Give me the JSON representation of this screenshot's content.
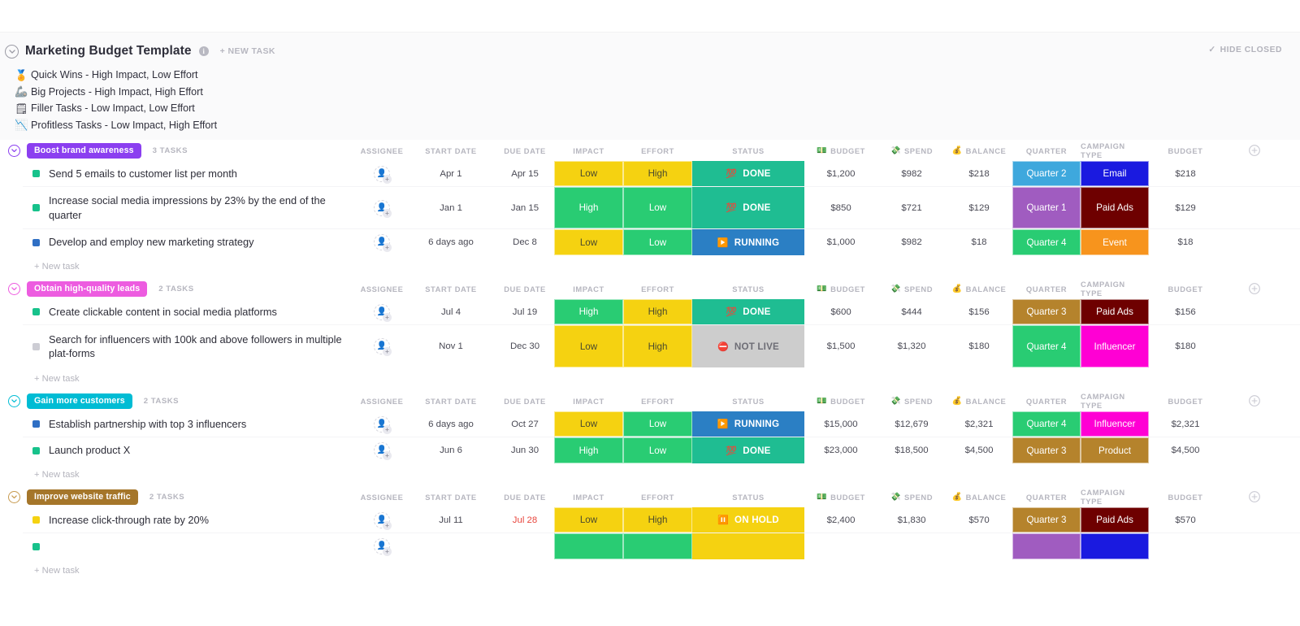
{
  "header": {
    "title": "Marketing Budget Template",
    "info_icon": "info-icon",
    "new_task_label": "+ NEW TASK",
    "hide_closed_label": "HIDE CLOSED",
    "hide_closed_check": "✓",
    "legend": [
      {
        "emoji": "🏅",
        "text": "Quick Wins - High Impact, Low Effort"
      },
      {
        "emoji": "🦾",
        "text": "Big Projects - High Impact, High Effort"
      },
      {
        "emoji": "🗒",
        "text": "Filler Tasks - Low Impact, Low Effort"
      },
      {
        "emoji": "📉",
        "text": "Profitless Tasks - Low Impact, High Effort"
      }
    ]
  },
  "columns": {
    "assignee": "ASSIGNEE",
    "start_date": "START DATE",
    "due_date": "DUE DATE",
    "impact": "IMPACT",
    "effort": "EFFORT",
    "status": "STATUS",
    "budget": "BUDGET",
    "budget_emoji": "💵",
    "spend": "SPEND",
    "spend_emoji": "💸",
    "balance": "BALANCE",
    "balance_emoji": "💰",
    "quarter": "QUARTER",
    "campaign_type": "CAMPAIGN TYPE",
    "budget2": "BUDGET",
    "add_column": "+"
  },
  "palette": {
    "impact_high": "#29cc73",
    "impact_low": "#f5d211",
    "effort_high": "#f5d211",
    "effort_low": "#29cc73",
    "status_done": "#1fbd92",
    "status_running": "#2b7fc4",
    "status_not_live": "#cdcdcd",
    "status_on_hold": "#f5d211",
    "quarter1": "#a05cc0",
    "quarter2": "#3ea8dd",
    "quarter3": "#b5832c",
    "quarter4": "#29cc73",
    "campaign_email": "#1a1ae0",
    "campaign_paid_ads": "#6e0000",
    "campaign_event": "#f7941d",
    "campaign_influencer": "#ff00d4",
    "campaign_product": "#b5832c"
  },
  "new_task_label": "+ New task",
  "groups": [
    {
      "name": "Boost brand awareness",
      "badge_color": "#8b3ff0",
      "chev_color": "#8b3ff0",
      "task_count": "3 TASKS",
      "tasks": [
        {
          "priority_color": "#17c28b",
          "name": "Send 5 emails to customer list per month",
          "start_date": "Apr 1",
          "due_date": "Apr 15",
          "due_overdue": false,
          "impact": "Low",
          "impact_color": "#f5d211",
          "impact_text": "#4a4a2e",
          "effort": "High",
          "effort_color": "#f5d211",
          "effort_text": "#4a4a2e",
          "status": "DONE",
          "status_emoji": "💯",
          "status_color": "#1fbd92",
          "status_text": "#ffffff",
          "budget": "$1,200",
          "spend": "$982",
          "balance": "$218",
          "quarter": "Quarter 2",
          "quarter_color": "#3ea8dd",
          "campaign": "Email",
          "campaign_color": "#1a1ae0",
          "budget2": "$218"
        },
        {
          "priority_color": "#17c28b",
          "name": "Increase social media impressions by 23% by the end of the quarter",
          "start_date": "Jan 1",
          "due_date": "Jan 15",
          "due_overdue": false,
          "impact": "High",
          "impact_color": "#29cc73",
          "impact_text": "#ffffff",
          "effort": "Low",
          "effort_color": "#29cc73",
          "effort_text": "#ffffff",
          "status": "DONE",
          "status_emoji": "💯",
          "status_color": "#1fbd92",
          "status_text": "#ffffff",
          "budget": "$850",
          "spend": "$721",
          "balance": "$129",
          "quarter": "Quarter 1",
          "quarter_color": "#a05cc0",
          "campaign": "Paid Ads",
          "campaign_color": "#6e0000",
          "budget2": "$129"
        },
        {
          "priority_color": "#2f6fc4",
          "name": "Develop and employ new marketing strategy",
          "start_date": "6 days ago",
          "due_date": "Dec 8",
          "due_overdue": false,
          "impact": "Low",
          "impact_color": "#f5d211",
          "impact_text": "#4a4a2e",
          "effort": "Low",
          "effort_color": "#29cc73",
          "effort_text": "#ffffff",
          "status": "RUNNING",
          "status_emoji": "▶️",
          "status_color": "#2b7fc4",
          "status_text": "#ffffff",
          "budget": "$1,000",
          "spend": "$982",
          "balance": "$18",
          "quarter": "Quarter 4",
          "quarter_color": "#29cc73",
          "campaign": "Event",
          "campaign_color": "#f7941d",
          "budget2": "$18"
        }
      ]
    },
    {
      "name": "Obtain high-quality leads",
      "badge_color": "#ed5ce0",
      "chev_color": "#ed5ce0",
      "task_count": "2 TASKS",
      "tasks": [
        {
          "priority_color": "#17c28b",
          "name": "Create clickable content in social media platforms",
          "start_date": "Jul 4",
          "due_date": "Jul 19",
          "due_overdue": false,
          "impact": "High",
          "impact_color": "#29cc73",
          "impact_text": "#ffffff",
          "effort": "High",
          "effort_color": "#f5d211",
          "effort_text": "#4a4a2e",
          "status": "DONE",
          "status_emoji": "💯",
          "status_color": "#1fbd92",
          "status_text": "#ffffff",
          "budget": "$600",
          "spend": "$444",
          "balance": "$156",
          "quarter": "Quarter 3",
          "quarter_color": "#b5832c",
          "campaign": "Paid Ads",
          "campaign_color": "#6e0000",
          "budget2": "$156"
        },
        {
          "priority_color": "#cdcdd4",
          "name": "Search for influencers with 100k and above followers in multiple plat-forms",
          "start_date": "Nov 1",
          "due_date": "Dec 30",
          "due_overdue": false,
          "impact": "Low",
          "impact_color": "#f5d211",
          "impact_text": "#4a4a2e",
          "effort": "High",
          "effort_color": "#f5d211",
          "effort_text": "#4a4a2e",
          "status": "NOT LIVE",
          "status_emoji": "⛔",
          "status_color": "#cdcdcd",
          "status_text": "#6d6d75",
          "budget": "$1,500",
          "spend": "$1,320",
          "balance": "$180",
          "quarter": "Quarter 4",
          "quarter_color": "#29cc73",
          "campaign": "Influencer",
          "campaign_color": "#ff00d4",
          "budget2": "$180"
        }
      ]
    },
    {
      "name": "Gain more customers",
      "badge_color": "#00bcd4",
      "chev_color": "#00bcd4",
      "task_count": "2 TASKS",
      "tasks": [
        {
          "priority_color": "#2f6fc4",
          "name": "Establish partnership with top 3 influencers",
          "start_date": "6 days ago",
          "due_date": "Oct 27",
          "due_overdue": false,
          "impact": "Low",
          "impact_color": "#f5d211",
          "impact_text": "#4a4a2e",
          "effort": "Low",
          "effort_color": "#29cc73",
          "effort_text": "#ffffff",
          "status": "RUNNING",
          "status_emoji": "▶️",
          "status_color": "#2b7fc4",
          "status_text": "#ffffff",
          "budget": "$15,000",
          "spend": "$12,679",
          "balance": "$2,321",
          "quarter": "Quarter 4",
          "quarter_color": "#29cc73",
          "campaign": "Influencer",
          "campaign_color": "#ff00d4",
          "budget2": "$2,321"
        },
        {
          "priority_color": "#17c28b",
          "name": "Launch product X",
          "start_date": "Jun 6",
          "due_date": "Jun 30",
          "due_overdue": false,
          "impact": "High",
          "impact_color": "#29cc73",
          "impact_text": "#ffffff",
          "effort": "Low",
          "effort_color": "#29cc73",
          "effort_text": "#ffffff",
          "status": "DONE",
          "status_emoji": "💯",
          "status_color": "#1fbd92",
          "status_text": "#ffffff",
          "budget": "$23,000",
          "spend": "$18,500",
          "balance": "$4,500",
          "quarter": "Quarter 3",
          "quarter_color": "#b5832c",
          "campaign": "Product",
          "campaign_color": "#b5832c",
          "budget2": "$4,500"
        }
      ]
    },
    {
      "name": "Improve website traffic",
      "badge_color": "#a5762a",
      "chev_color": "#c79a4e",
      "task_count": "2 TASKS",
      "tasks": [
        {
          "priority_color": "#f5d211",
          "name": "Increase click-through rate by 20%",
          "start_date": "Jul 11",
          "due_date": "Jul 28",
          "due_overdue": true,
          "impact": "Low",
          "impact_color": "#f5d211",
          "impact_text": "#4a4a2e",
          "effort": "High",
          "effort_color": "#f5d211",
          "effort_text": "#4a4a2e",
          "status": "ON HOLD",
          "status_emoji": "⏸️",
          "status_color": "#f5d211",
          "status_text": "#ffffff",
          "budget": "$2,400",
          "spend": "$1,830",
          "balance": "$570",
          "quarter": "Quarter 3",
          "quarter_color": "#b5832c",
          "campaign": "Paid Ads",
          "campaign_color": "#6e0000",
          "budget2": "$570"
        },
        {
          "priority_color": "#17c28b",
          "name": "",
          "start_date": "",
          "due_date": "",
          "due_overdue": false,
          "impact": "",
          "impact_color": "#29cc73",
          "impact_text": "#ffffff",
          "effort": "",
          "effort_color": "#29cc73",
          "effort_text": "#ffffff",
          "status": "",
          "status_emoji": "",
          "status_color": "#f5d211",
          "status_text": "#ffffff",
          "budget": "",
          "spend": "",
          "balance": "",
          "quarter": "",
          "quarter_color": "#a05cc0",
          "campaign": "",
          "campaign_color": "#1a1ae0",
          "budget2": ""
        }
      ]
    }
  ]
}
